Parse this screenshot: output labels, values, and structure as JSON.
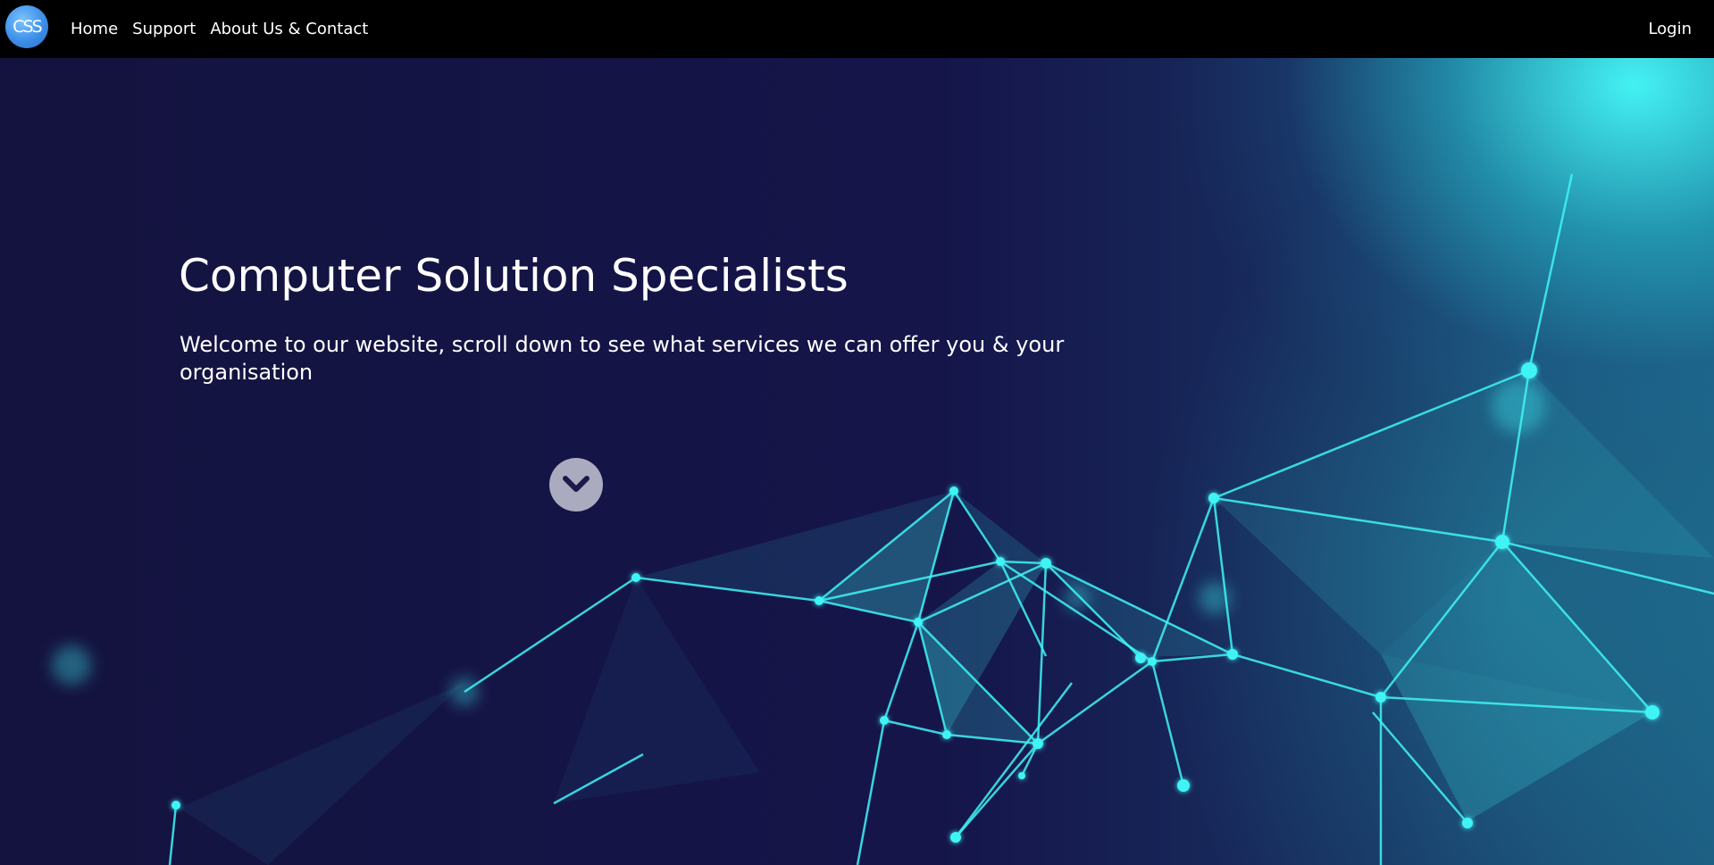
{
  "nav": {
    "logo_text": "CSS",
    "links": [
      "Home",
      "Support",
      "About Us & Contact"
    ],
    "login": "Login"
  },
  "hero": {
    "title": "Computer Solution Specialists",
    "subtitle": "Welcome to our website, scroll down to see what services we can offer you & your organisation"
  },
  "icons": {
    "scroll": "chevron-down-icon",
    "logo": "css-logo-icon"
  },
  "colors": {
    "navbar_bg": "#000000",
    "hero_bg": "#14133f",
    "accent_cyan": "#3ff4f6",
    "logo_blue": "#3d8fe8",
    "text": "#ffffff"
  }
}
